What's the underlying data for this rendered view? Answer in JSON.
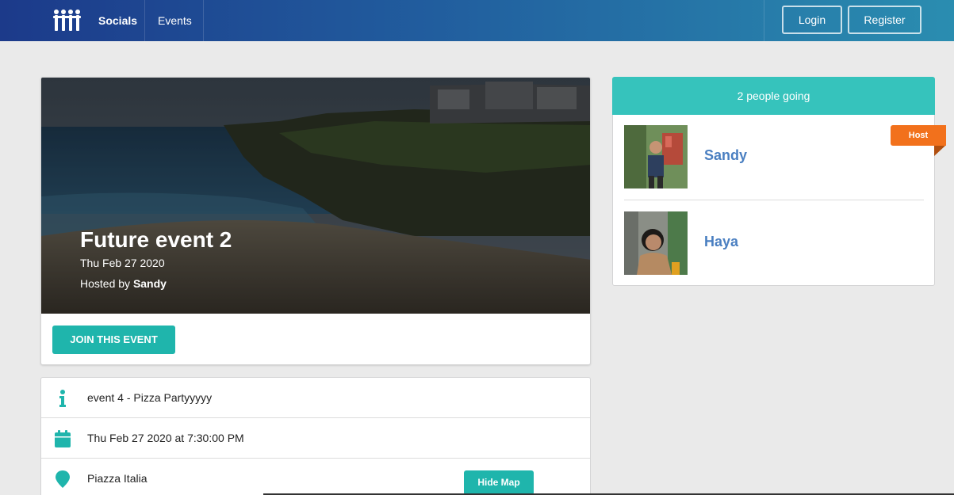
{
  "navbar": {
    "brand": "Socials",
    "items": [
      "Events"
    ],
    "login_label": "Login",
    "register_label": "Register",
    "logo_icon": "people-logo-icon"
  },
  "event": {
    "title": "Future event 2",
    "date": "Thu Feb 27 2020",
    "hosted_by_prefix": "Hosted by ",
    "host_name": "Sandy",
    "join_label": "JOIN THIS EVENT"
  },
  "details": {
    "description": "event 4 - Pizza Partyyyyy",
    "datetime": "Thu Feb 27 2020 at 7:30:00 PM",
    "venue": "Piazza Italia",
    "hide_map_label": "Hide Map"
  },
  "attendees": {
    "header": "2 people going",
    "host_badge": "Host",
    "list": [
      {
        "name": "Sandy",
        "is_host": true
      },
      {
        "name": "Haya",
        "is_host": false
      }
    ]
  },
  "colors": {
    "accent": "#1fb5ac",
    "attendee_header": "#36c3bc",
    "host_badge": "#f2711c",
    "name_link": "#4a7fc1"
  }
}
